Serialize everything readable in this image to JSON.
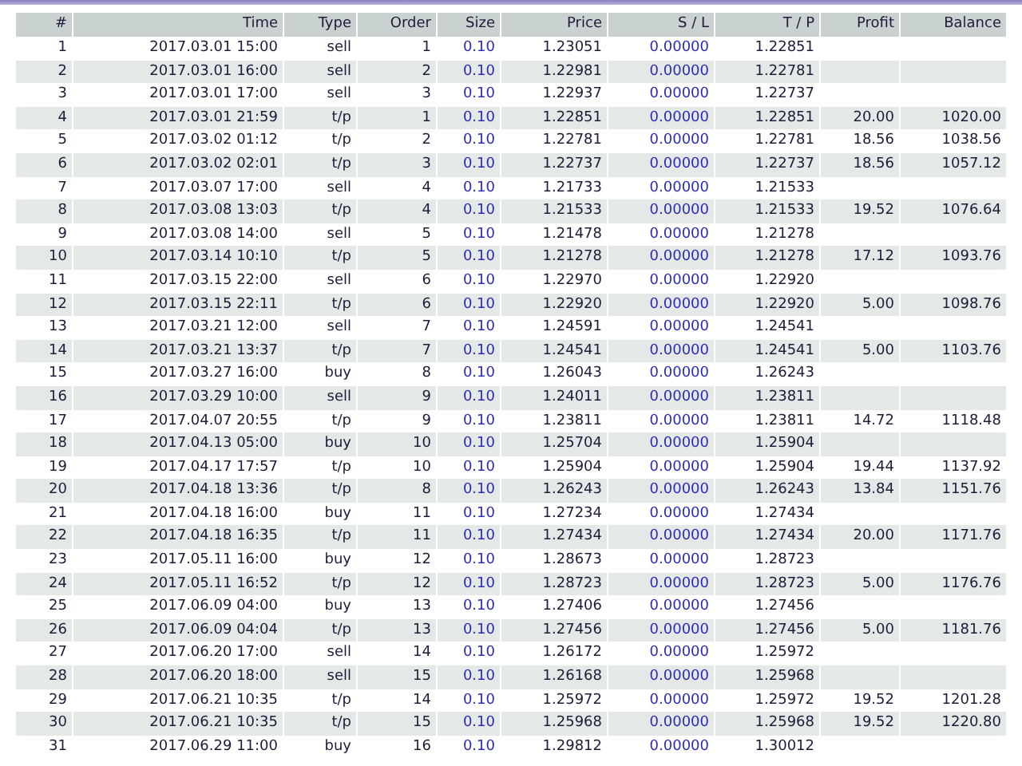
{
  "table": {
    "columns": [
      "#",
      "Time",
      "Type",
      "Order",
      "Size",
      "Price",
      "S / L",
      "T / P",
      "Profit",
      "Balance"
    ],
    "rows": [
      {
        "n": "1",
        "time": "2017.03.01 15:00",
        "type": "sell",
        "order": "1",
        "size": "0.10",
        "price": "1.23051",
        "sl": "0.00000",
        "tp": "1.22851"
      },
      {
        "n": "2",
        "time": "2017.03.01 16:00",
        "type": "sell",
        "order": "2",
        "size": "0.10",
        "price": "1.22981",
        "sl": "0.00000",
        "tp": "1.22781"
      },
      {
        "n": "3",
        "time": "2017.03.01 17:00",
        "type": "sell",
        "order": "3",
        "size": "0.10",
        "price": "1.22937",
        "sl": "0.00000",
        "tp": "1.22737"
      },
      {
        "n": "4",
        "time": "2017.03.01 21:59",
        "type": "t/p",
        "order": "1",
        "size": "0.10",
        "price": "1.22851",
        "sl": "0.00000",
        "tp": "1.22851",
        "profit": "20.00",
        "balance": "1020.00"
      },
      {
        "n": "5",
        "time": "2017.03.02 01:12",
        "type": "t/p",
        "order": "2",
        "size": "0.10",
        "price": "1.22781",
        "sl": "0.00000",
        "tp": "1.22781",
        "profit": "18.56",
        "balance": "1038.56"
      },
      {
        "n": "6",
        "time": "2017.03.02 02:01",
        "type": "t/p",
        "order": "3",
        "size": "0.10",
        "price": "1.22737",
        "sl": "0.00000",
        "tp": "1.22737",
        "profit": "18.56",
        "balance": "1057.12"
      },
      {
        "n": "7",
        "time": "2017.03.07 17:00",
        "type": "sell",
        "order": "4",
        "size": "0.10",
        "price": "1.21733",
        "sl": "0.00000",
        "tp": "1.21533"
      },
      {
        "n": "8",
        "time": "2017.03.08 13:03",
        "type": "t/p",
        "order": "4",
        "size": "0.10",
        "price": "1.21533",
        "sl": "0.00000",
        "tp": "1.21533",
        "profit": "19.52",
        "balance": "1076.64"
      },
      {
        "n": "9",
        "time": "2017.03.08 14:00",
        "type": "sell",
        "order": "5",
        "size": "0.10",
        "price": "1.21478",
        "sl": "0.00000",
        "tp": "1.21278"
      },
      {
        "n": "10",
        "time": "2017.03.14 10:10",
        "type": "t/p",
        "order": "5",
        "size": "0.10",
        "price": "1.21278",
        "sl": "0.00000",
        "tp": "1.21278",
        "profit": "17.12",
        "balance": "1093.76"
      },
      {
        "n": "11",
        "time": "2017.03.15 22:00",
        "type": "sell",
        "order": "6",
        "size": "0.10",
        "price": "1.22970",
        "sl": "0.00000",
        "tp": "1.22920"
      },
      {
        "n": "12",
        "time": "2017.03.15 22:11",
        "type": "t/p",
        "order": "6",
        "size": "0.10",
        "price": "1.22920",
        "sl": "0.00000",
        "tp": "1.22920",
        "profit": "5.00",
        "balance": "1098.76"
      },
      {
        "n": "13",
        "time": "2017.03.21 12:00",
        "type": "sell",
        "order": "7",
        "size": "0.10",
        "price": "1.24591",
        "sl": "0.00000",
        "tp": "1.24541"
      },
      {
        "n": "14",
        "time": "2017.03.21 13:37",
        "type": "t/p",
        "order": "7",
        "size": "0.10",
        "price": "1.24541",
        "sl": "0.00000",
        "tp": "1.24541",
        "profit": "5.00",
        "balance": "1103.76"
      },
      {
        "n": "15",
        "time": "2017.03.27 16:00",
        "type": "buy",
        "order": "8",
        "size": "0.10",
        "price": "1.26043",
        "sl": "0.00000",
        "tp": "1.26243"
      },
      {
        "n": "16",
        "time": "2017.03.29 10:00",
        "type": "sell",
        "order": "9",
        "size": "0.10",
        "price": "1.24011",
        "sl": "0.00000",
        "tp": "1.23811"
      },
      {
        "n": "17",
        "time": "2017.04.07 20:55",
        "type": "t/p",
        "order": "9",
        "size": "0.10",
        "price": "1.23811",
        "sl": "0.00000",
        "tp": "1.23811",
        "profit": "14.72",
        "balance": "1118.48"
      },
      {
        "n": "18",
        "time": "2017.04.13 05:00",
        "type": "buy",
        "order": "10",
        "size": "0.10",
        "price": "1.25704",
        "sl": "0.00000",
        "tp": "1.25904"
      },
      {
        "n": "19",
        "time": "2017.04.17 17:57",
        "type": "t/p",
        "order": "10",
        "size": "0.10",
        "price": "1.25904",
        "sl": "0.00000",
        "tp": "1.25904",
        "profit": "19.44",
        "balance": "1137.92"
      },
      {
        "n": "20",
        "time": "2017.04.18 13:36",
        "type": "t/p",
        "order": "8",
        "size": "0.10",
        "price": "1.26243",
        "sl": "0.00000",
        "tp": "1.26243",
        "profit": "13.84",
        "balance": "1151.76"
      },
      {
        "n": "21",
        "time": "2017.04.18 16:00",
        "type": "buy",
        "order": "11",
        "size": "0.10",
        "price": "1.27234",
        "sl": "0.00000",
        "tp": "1.27434"
      },
      {
        "n": "22",
        "time": "2017.04.18 16:35",
        "type": "t/p",
        "order": "11",
        "size": "0.10",
        "price": "1.27434",
        "sl": "0.00000",
        "tp": "1.27434",
        "profit": "20.00",
        "balance": "1171.76"
      },
      {
        "n": "23",
        "time": "2017.05.11 16:00",
        "type": "buy",
        "order": "12",
        "size": "0.10",
        "price": "1.28673",
        "sl": "0.00000",
        "tp": "1.28723"
      },
      {
        "n": "24",
        "time": "2017.05.11 16:52",
        "type": "t/p",
        "order": "12",
        "size": "0.10",
        "price": "1.28723",
        "sl": "0.00000",
        "tp": "1.28723",
        "profit": "5.00",
        "balance": "1176.76"
      },
      {
        "n": "25",
        "time": "2017.06.09 04:00",
        "type": "buy",
        "order": "13",
        "size": "0.10",
        "price": "1.27406",
        "sl": "0.00000",
        "tp": "1.27456"
      },
      {
        "n": "26",
        "time": "2017.06.09 04:04",
        "type": "t/p",
        "order": "13",
        "size": "0.10",
        "price": "1.27456",
        "sl": "0.00000",
        "tp": "1.27456",
        "profit": "5.00",
        "balance": "1181.76"
      },
      {
        "n": "27",
        "time": "2017.06.20 17:00",
        "type": "sell",
        "order": "14",
        "size": "0.10",
        "price": "1.26172",
        "sl": "0.00000",
        "tp": "1.25972"
      },
      {
        "n": "28",
        "time": "2017.06.20 18:00",
        "type": "sell",
        "order": "15",
        "size": "0.10",
        "price": "1.26168",
        "sl": "0.00000",
        "tp": "1.25968"
      },
      {
        "n": "29",
        "time": "2017.06.21 10:35",
        "type": "t/p",
        "order": "14",
        "size": "0.10",
        "price": "1.25972",
        "sl": "0.00000",
        "tp": "1.25972",
        "profit": "19.52",
        "balance": "1201.28"
      },
      {
        "n": "30",
        "time": "2017.06.21 10:35",
        "type": "t/p",
        "order": "15",
        "size": "0.10",
        "price": "1.25968",
        "sl": "0.00000",
        "tp": "1.25968",
        "profit": "19.52",
        "balance": "1220.80"
      },
      {
        "n": "31",
        "time": "2017.06.29 11:00",
        "type": "buy",
        "order": "16",
        "size": "0.10",
        "price": "1.29812",
        "sl": "0.00000",
        "tp": "1.30012"
      }
    ]
  }
}
